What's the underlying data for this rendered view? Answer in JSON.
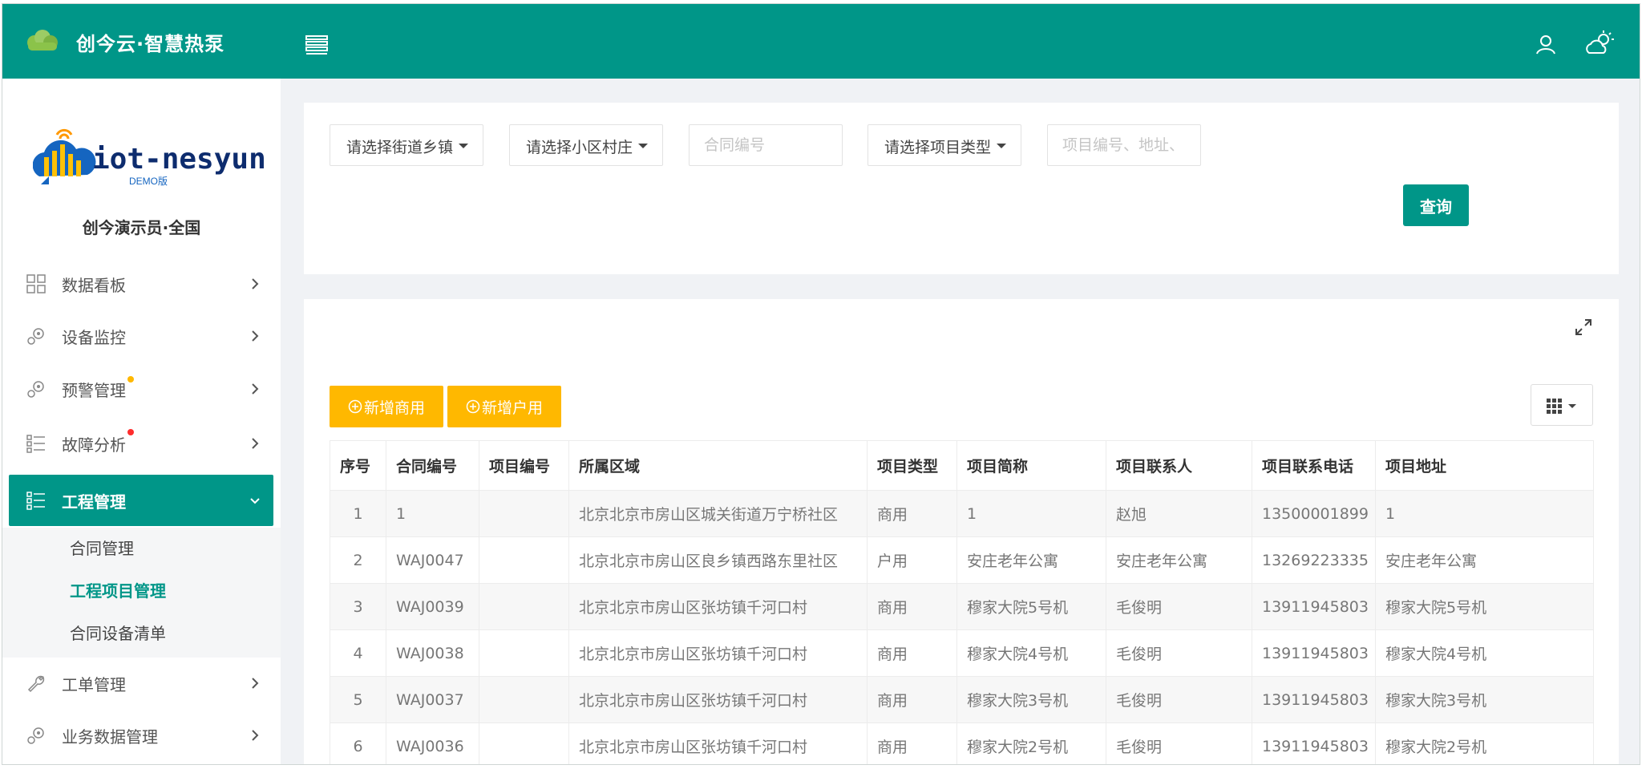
{
  "header": {
    "app_title": "创今云·智慧热泵",
    "accent_color": "#009688"
  },
  "sidebar": {
    "brand_text": "iot-nesyun",
    "brand_badge": "DEMO版",
    "user_label": "创今演示员·全国",
    "items": [
      {
        "label": "数据看板",
        "icon": "grid-icon"
      },
      {
        "label": "设备监控",
        "icon": "gears-icon"
      },
      {
        "label": "预警管理",
        "icon": "gears-icon",
        "dot": "#ffb800"
      },
      {
        "label": "故障分析",
        "icon": "checklist-icon",
        "dot": "#ff2d2d"
      },
      {
        "label": "工程管理",
        "icon": "checklist-icon",
        "active": true
      },
      {
        "label": "工单管理",
        "icon": "wrench-icon"
      },
      {
        "label": "业务数据管理",
        "icon": "gears-icon"
      }
    ],
    "submenu": [
      {
        "label": "合同管理"
      },
      {
        "label": "工程项目管理",
        "active": true
      },
      {
        "label": "合同设备清单"
      }
    ]
  },
  "filters": {
    "street_select": "请选择街道乡镇",
    "community_select": "请选择小区村庄",
    "contract_placeholder": "合同编号",
    "type_select": "请选择项目类型",
    "keyword_placeholder": "项目编号、地址、",
    "query_label": "查询"
  },
  "toolbar": {
    "add_commercial": "新增商用",
    "add_household": "新增户用"
  },
  "table": {
    "columns": [
      "序号",
      "合同编号",
      "项目编号",
      "所属区域",
      "项目类型",
      "项目简称",
      "项目联系人",
      "项目联系电话",
      "项目地址"
    ],
    "rows": [
      [
        "1",
        "1",
        "",
        "北京北京市房山区城关街道万宁桥社区",
        "商用",
        "1",
        "赵旭",
        "13500001899",
        "1"
      ],
      [
        "2",
        "WAJ0047",
        "",
        "北京北京市房山区良乡镇西路东里社区",
        "户用",
        "安庄老年公寓",
        "安庄老年公寓",
        "13269223335",
        "安庄老年公寓"
      ],
      [
        "3",
        "WAJ0039",
        "",
        "北京北京市房山区张坊镇千河口村",
        "商用",
        "穆家大院5号机",
        "毛俊明",
        "13911945803",
        "穆家大院5号机"
      ],
      [
        "4",
        "WAJ0038",
        "",
        "北京北京市房山区张坊镇千河口村",
        "商用",
        "穆家大院4号机",
        "毛俊明",
        "13911945803",
        "穆家大院4号机"
      ],
      [
        "5",
        "WAJ0037",
        "",
        "北京北京市房山区张坊镇千河口村",
        "商用",
        "穆家大院3号机",
        "毛俊明",
        "13911945803",
        "穆家大院3号机"
      ],
      [
        "6",
        "WAJ0036",
        "",
        "北京北京市房山区张坊镇千河口村",
        "商用",
        "穆家大院2号机",
        "毛俊明",
        "13911945803",
        "穆家大院2号机"
      ]
    ]
  }
}
